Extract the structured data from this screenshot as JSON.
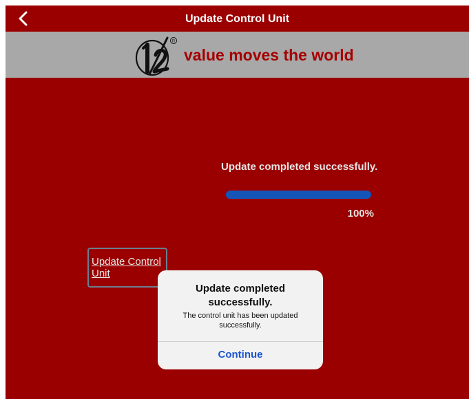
{
  "nav": {
    "back_icon": "chevron-left-icon",
    "title": "Update Control Unit"
  },
  "banner": {
    "logo": "1/2",
    "tagline": "value moves the world"
  },
  "status": {
    "message": "Update completed successfully.",
    "progress_fraction": 1.0,
    "percent_label": "100%"
  },
  "update_button": {
    "label": "Update Control Unit"
  },
  "dialog": {
    "title": "Update completed successfully.",
    "message": "The control unit has been updated successfully.",
    "button_label": "Continue"
  },
  "colors": {
    "background": "#9b0000",
    "banner": "#a8a8a8",
    "tagline": "#a50000",
    "progress_fill": "#1555b8",
    "dialog_button": "#1a55d0"
  }
}
